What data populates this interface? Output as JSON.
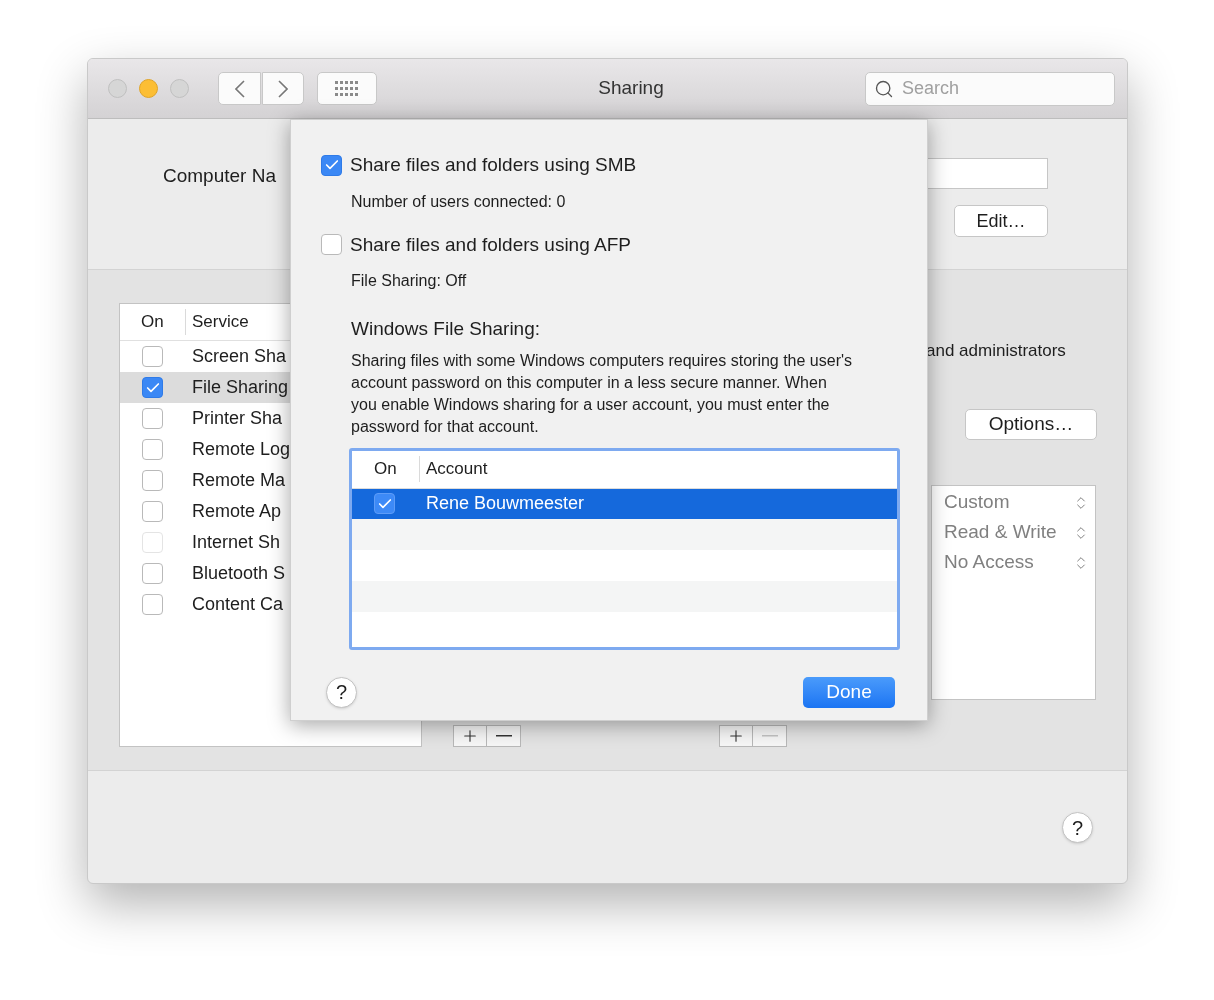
{
  "window": {
    "title": "Sharing"
  },
  "search": {
    "placeholder": "Search"
  },
  "computer_name": {
    "label": "Computer Na"
  },
  "edit_button": "Edit…",
  "services": {
    "columns": [
      "On",
      "Service"
    ],
    "rows": [
      {
        "name": "Screen Sha",
        "checked": false,
        "selected": false,
        "disabled": false
      },
      {
        "name": "File Sharing",
        "checked": true,
        "selected": true,
        "disabled": false
      },
      {
        "name": "Printer Sha",
        "checked": false,
        "selected": false,
        "disabled": false
      },
      {
        "name": "Remote Log",
        "checked": false,
        "selected": false,
        "disabled": false
      },
      {
        "name": "Remote Ma",
        "checked": false,
        "selected": false,
        "disabled": false
      },
      {
        "name": "Remote Ap",
        "checked": false,
        "selected": false,
        "disabled": false
      },
      {
        "name": "Internet Sh",
        "checked": false,
        "selected": false,
        "disabled": true
      },
      {
        "name": "Bluetooth S",
        "checked": false,
        "selected": false,
        "disabled": false
      },
      {
        "name": "Content Ca",
        "checked": false,
        "selected": false,
        "disabled": false
      }
    ]
  },
  "access_note": "and administrators",
  "options_button": "Options…",
  "permissions": [
    {
      "label": "Custom"
    },
    {
      "label": "Read & Write"
    },
    {
      "label": "No Access"
    }
  ],
  "list_buttons": [
    {
      "remove_disabled": false
    },
    {
      "remove_disabled": true
    }
  ],
  "help_label": "?",
  "sheet": {
    "options": [
      {
        "label": "Share files and folders using SMB",
        "checked": true,
        "status": "Number of users connected: 0"
      },
      {
        "label": "Share files and folders using AFP",
        "checked": false,
        "status": "File Sharing: Off"
      }
    ],
    "heading": "Windows File Sharing:",
    "description": "Sharing files with some Windows computers requires storing the user's account password on this computer in a less secure manner. When you enable Windows sharing for a user account, you must enter the password for that account.",
    "accounts": {
      "columns": [
        "On",
        "Account"
      ],
      "rows": [
        {
          "name": "Rene Bouwmeester",
          "checked": true,
          "selected": true
        }
      ]
    },
    "help_label": "?",
    "done_button": "Done"
  }
}
